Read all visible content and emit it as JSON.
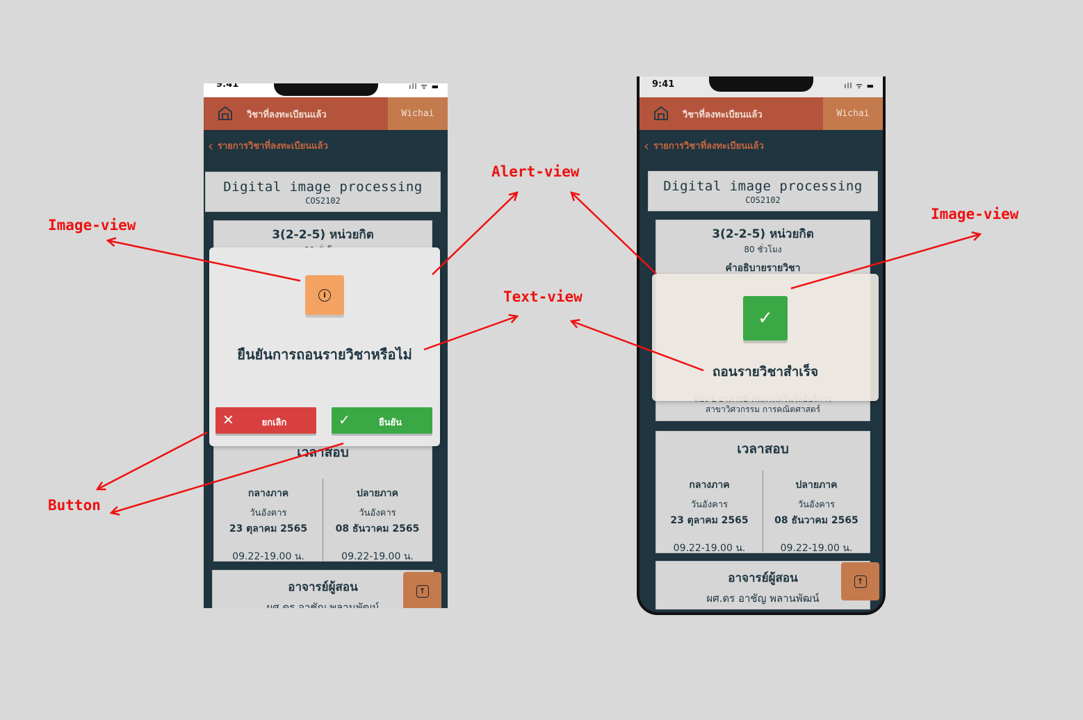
{
  "status": {
    "time": "9:41",
    "signal": "ıll ᯤ ▬"
  },
  "app": {
    "title": "วิชาที่ลงทะเบียนแล้ว",
    "user": "Wichai",
    "back_label": "รายการวิชาที่ลงทะเบียนแล้ว"
  },
  "course": {
    "name": "Digital image processing",
    "code": "COS2102",
    "credits": "3(2-2-5)  หน่วยกิต",
    "hours": "80 ชั่วโมง",
    "description_header": "คำอธิบายรายวิชา",
    "room": "ห้อง L อาคารB คณะเทคโนโลยีบริการ",
    "dept": "สาขาวิศวกรรม การคณิตศาสตร์"
  },
  "exam": {
    "header": "เวลาสอบ",
    "midterm": {
      "label": "กลางภาค",
      "day": "วันอังคาร",
      "date": "23 ตุลาคม 2565",
      "time": "09.22-19.00 น."
    },
    "final": {
      "label": "ปลายภาค",
      "day": "วันอังคาร",
      "date": "08 ธันวาคม 2565",
      "time": "09.22-19.00 น."
    }
  },
  "teacher": {
    "header": "อาจารย์ผู้สอน",
    "name": "ผศ.ดร อาชัญ พลานพัฒน์"
  },
  "confirm_dialog": {
    "message": "ยืนยันการถอนรายวิชาหรือไม่",
    "cancel_label": "ยกเลิก",
    "confirm_label": "ยืนยัน"
  },
  "success_dialog": {
    "message": "ถอนรายวิชาสำเร็จ"
  },
  "annotations": {
    "image_view": "Image-view",
    "alert_view": "Alert-view",
    "text_view": "Text-view",
    "button": "Button"
  },
  "colors": {
    "background": "#d9d9d9",
    "app_bg": "#1f3540",
    "appbar": "#b5543c",
    "accent": "#c47a4d",
    "danger": "#d84040",
    "success": "#3aa845",
    "info": "#f4a261",
    "annotation": "#ee1111"
  }
}
